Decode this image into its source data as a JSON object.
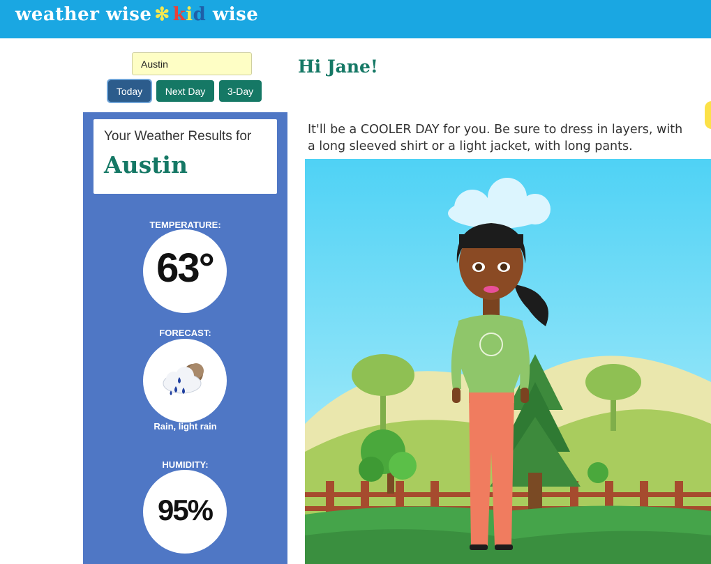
{
  "header": {
    "logo_part1": "weather wise",
    "logo_separator": "✻",
    "logo_kid_1": "k",
    "logo_kid_2": "i",
    "logo_kid_3": "d",
    "logo_part2": "wise",
    "background_color": "#1aa7e2"
  },
  "search": {
    "value": "Austin"
  },
  "buttons": {
    "today": "Today",
    "next_day": "Next Day",
    "three_day": "3-Day",
    "active": "Today"
  },
  "results": {
    "label": "Your Weather Results for",
    "city": "Austin"
  },
  "temperature": {
    "label": "TEMPERATURE:",
    "value": "63°"
  },
  "forecast": {
    "label": "FORECAST:",
    "icon": "rain-cloud-icon",
    "description": "Rain, light rain"
  },
  "humidity": {
    "label": "HUMIDITY:",
    "value": "95%"
  },
  "main": {
    "greeting": "Hi Jane!",
    "advice": "It'll be a COOLER DAY for you. Be sure to dress in layers, with a long sleeved shirt or a light jacket, with long pants."
  },
  "colors": {
    "accent_green": "#157865",
    "panel_blue": "#4f77c5",
    "input_yellow": "#fefec5",
    "active_button": "#2c5c8c"
  }
}
